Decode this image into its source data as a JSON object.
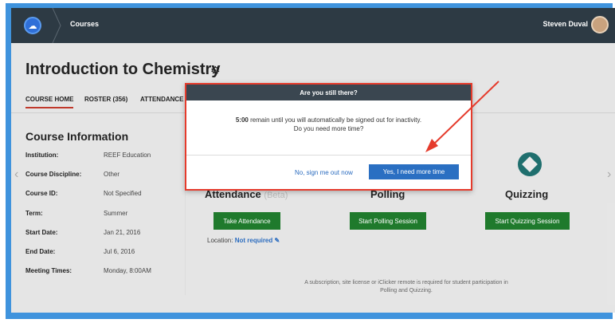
{
  "topbar": {
    "breadcrumb": "Courses",
    "user_name": "Steven Duval"
  },
  "page": {
    "title": "Introduction to Chemistry"
  },
  "tabs": [
    {
      "label": "COURSE HOME",
      "active": true
    },
    {
      "label": "ROSTER (356)",
      "active": false
    },
    {
      "label": "ATTENDANCE",
      "active": false
    }
  ],
  "course_info": {
    "title": "Course Information",
    "rows": [
      {
        "label": "Institution:",
        "value": "REEF Education"
      },
      {
        "label": "Course Discipline:",
        "value": "Other"
      },
      {
        "label": "Course ID:",
        "value": "Not Specified"
      },
      {
        "label": "Term:",
        "value": "Summer"
      },
      {
        "label": "Start Date:",
        "value": "Jan 21, 2016"
      },
      {
        "label": "End Date:",
        "value": "Jul 6, 2016"
      },
      {
        "label": "Meeting Times:",
        "value": "Monday, 8:00AM"
      }
    ]
  },
  "sections": {
    "attendance": {
      "title": "Attendance",
      "beta": "(Beta)",
      "button": "Take Attendance",
      "location_label": "Location:",
      "location_value": "Not required"
    },
    "polling": {
      "title": "Polling",
      "button": "Start Polling Session"
    },
    "quizzing": {
      "title": "Quizzing",
      "button": "Start Quizzing Session"
    }
  },
  "footnote": "A subscription, site license or iClicker remote is required for student participation in Polling and Quizzing.",
  "modal": {
    "title": "Are you still there?",
    "time": "5:00",
    "message1": "remain until you will automatically be signed out for inactivity.",
    "message2": "Do you need more time?",
    "no_label": "No, sign me out now",
    "yes_label": "Yes, I need more time"
  },
  "colors": {
    "frame": "#3f93dd",
    "topbar": "#2d3a44",
    "primary_button": "#2a6fc2",
    "green_button": "#1f7a2c",
    "highlight_border": "#e53b2c"
  }
}
